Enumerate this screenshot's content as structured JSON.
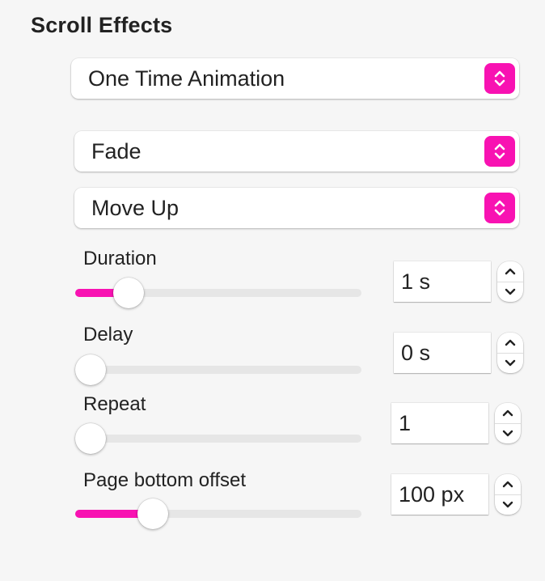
{
  "panel": {
    "title": "Scroll Effects"
  },
  "colors": {
    "accent": "#f812b2",
    "track": "#e6e6e6",
    "background": "#f6f6f6"
  },
  "selects": [
    {
      "name": "animation-type-select",
      "value": "One Time Animation"
    },
    {
      "name": "effect-select",
      "value": "Fade"
    },
    {
      "name": "direction-select",
      "value": "Move Up"
    }
  ],
  "controls": [
    {
      "name": "duration",
      "label": "Duration",
      "value": "1 s",
      "slider_fraction": 0.14
    },
    {
      "name": "delay",
      "label": "Delay",
      "value": "0 s",
      "slider_fraction": 0.0
    },
    {
      "name": "repeat",
      "label": "Repeat",
      "value": "1",
      "slider_fraction": 0.0
    },
    {
      "name": "page-bottom-offset",
      "label": "Page bottom offset",
      "value": "100 px",
      "slider_fraction": 0.23
    }
  ],
  "icons": {
    "select_stepper": "chevron-up-down-icon",
    "stepper_up": "chevron-up-icon",
    "stepper_down": "chevron-down-icon"
  }
}
